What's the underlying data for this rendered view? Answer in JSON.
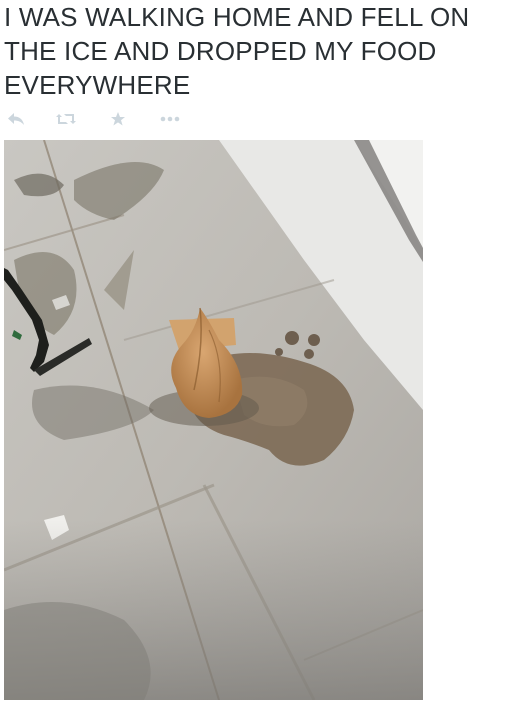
{
  "tweet": {
    "text": "I WAS WALKING HOME AND FELL ON THE ICE AND DROPPED MY FOOD EVERYWHERE"
  },
  "actions": [
    {
      "name": "reply",
      "icon": "reply-icon"
    },
    {
      "name": "retweet",
      "icon": "retweet-icon"
    },
    {
      "name": "favorite",
      "icon": "star-icon"
    },
    {
      "name": "more",
      "icon": "more-dots-icon"
    }
  ],
  "colors": {
    "text": "#292f33",
    "action_icon": "#ccd6dd"
  },
  "photo": {
    "subject": "paper-food-bag-on-icy-sidewalk"
  }
}
